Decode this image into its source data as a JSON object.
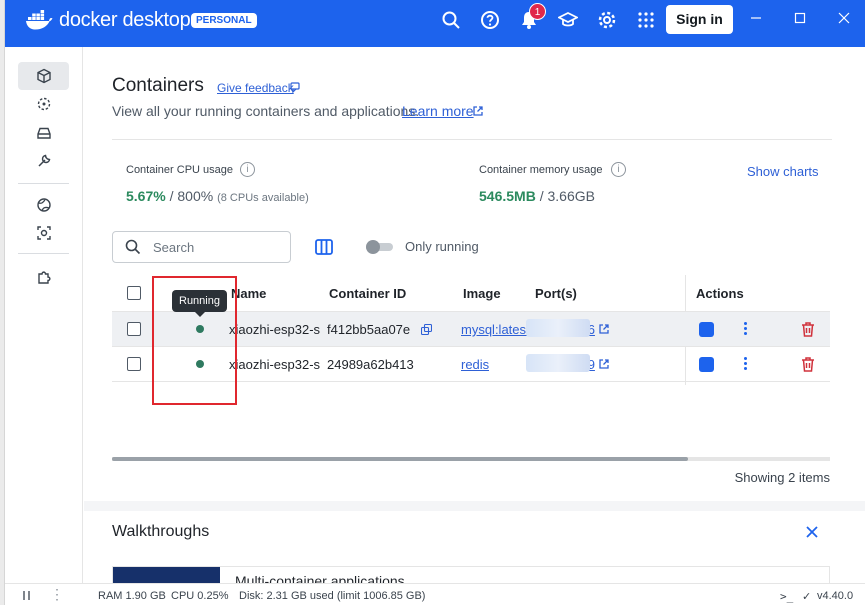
{
  "app": {
    "brand": "docker desktop",
    "badge": "PERSONAL",
    "notifications_count": "1",
    "sign_in": "Sign in"
  },
  "sidebar": {
    "items": [
      {
        "icon": "containers-icon",
        "active": true
      },
      {
        "icon": "images-icon"
      },
      {
        "icon": "volumes-icon"
      },
      {
        "icon": "builds-icon"
      },
      {
        "icon": "docker-hub-icon"
      },
      {
        "icon": "docker-scout-icon"
      },
      {
        "icon": "extensions-icon"
      }
    ]
  },
  "page": {
    "title": "Containers",
    "feedback": "Give feedback",
    "subtitle": "View all your running containers and applications.",
    "learn_more": "Learn more"
  },
  "stats": {
    "cpu_label": "Container CPU usage",
    "cpu_value": "5.67%",
    "cpu_total": "/ 800%",
    "cpu_note": "(8 CPUs available)",
    "mem_label": "Container memory usage",
    "mem_value": "546.5MB",
    "mem_total": "/ 3.66GB",
    "show_charts": "Show charts"
  },
  "toolbar": {
    "search_placeholder": "Search",
    "only_running": "Only running"
  },
  "table": {
    "headers": [
      "Name",
      "Container ID",
      "Image",
      "Port(s)",
      "Actions"
    ],
    "rows": [
      {
        "name": "xiaozhi-esp32-s",
        "id": "f412bb5aa07e",
        "image": "mysql:latest",
        "port": "3306",
        "status": "Running"
      },
      {
        "name": "xiaozhi-esp32-s",
        "id": "24989a62b413",
        "image": "redis",
        "port": "6379",
        "status": "Running"
      }
    ],
    "tooltip": "Running",
    "showing": "Showing 2 items"
  },
  "walkthroughs": {
    "title": "Walkthroughs",
    "card_title": "Multi-container applications"
  },
  "footer": {
    "ram": "RAM 1.90 GB",
    "cpu": "CPU 0.25%",
    "disk": "Disk: 2.31 GB used (limit 1006.85 GB)",
    "version": "v4.40.0"
  },
  "colors": {
    "accent": "#1d63ed",
    "running": "#2f7a60",
    "danger": "#d0323c"
  }
}
